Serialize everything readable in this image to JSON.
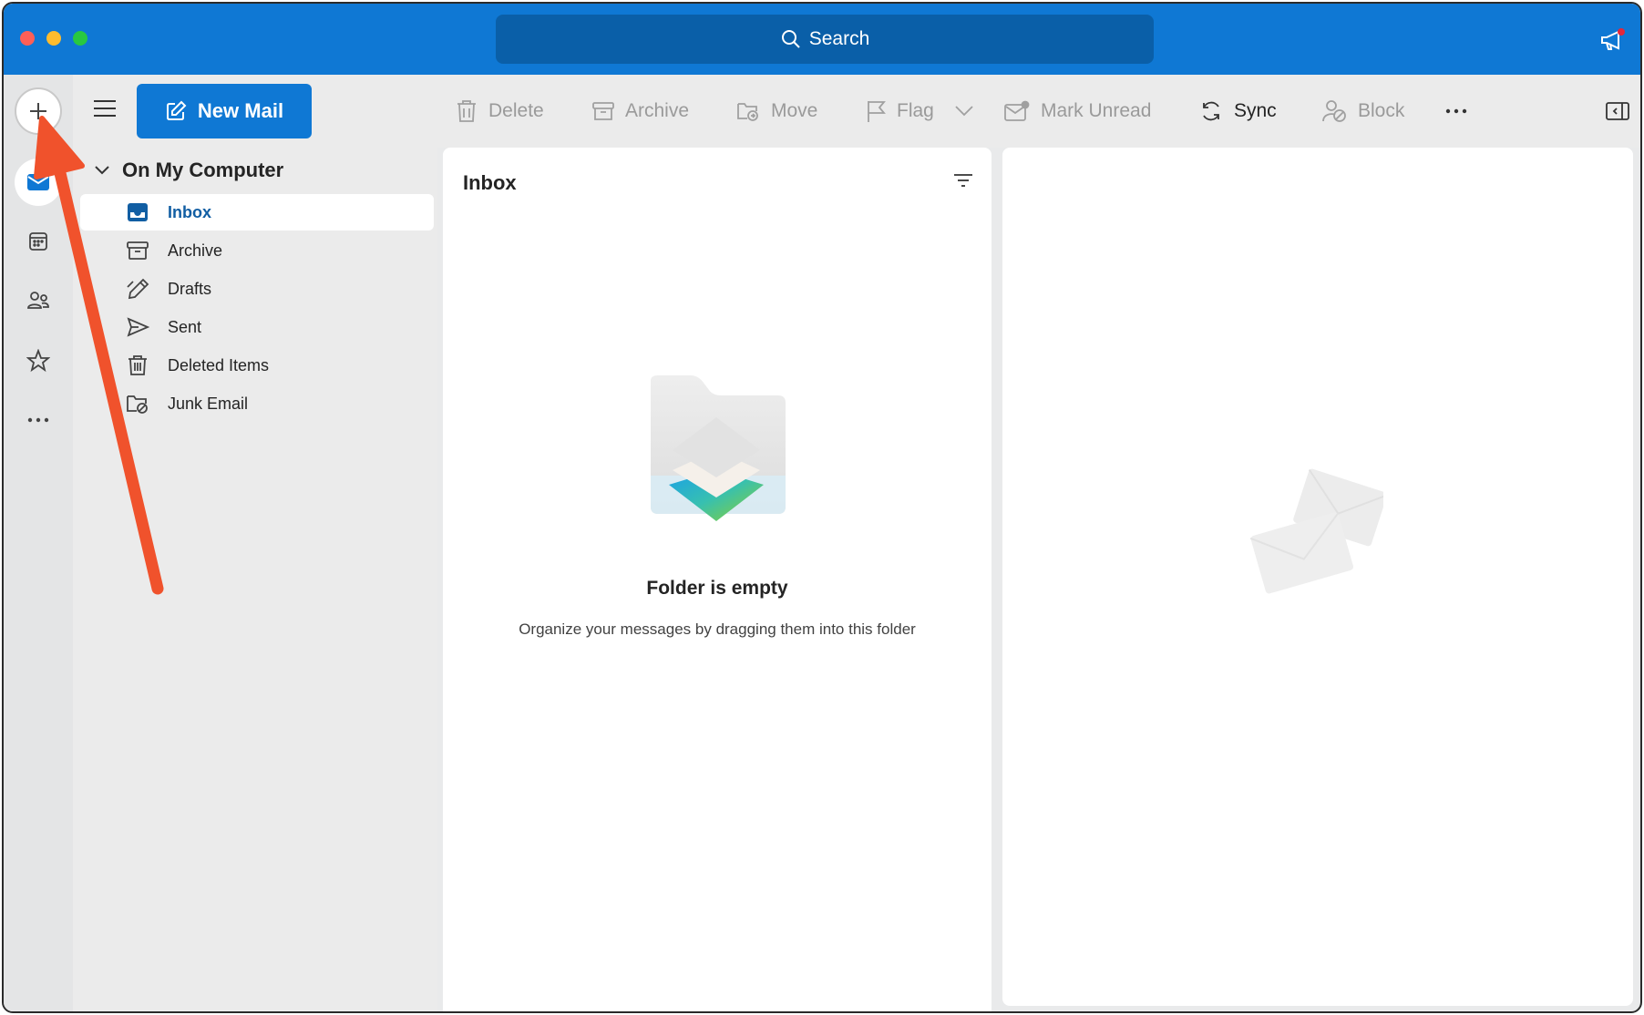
{
  "titlebar": {
    "search_label": "Search"
  },
  "rail": {
    "items": [
      "compose",
      "mail",
      "calendar",
      "people",
      "favorites",
      "more"
    ]
  },
  "folder_pane": {
    "new_mail_label": "New Mail",
    "account_label": "On My Computer",
    "folders": [
      {
        "label": "Inbox",
        "icon": "inbox-icon",
        "selected": true
      },
      {
        "label": "Archive",
        "icon": "archive-icon",
        "selected": false
      },
      {
        "label": "Drafts",
        "icon": "drafts-icon",
        "selected": false
      },
      {
        "label": "Sent",
        "icon": "sent-icon",
        "selected": false
      },
      {
        "label": "Deleted Items",
        "icon": "trash-icon",
        "selected": false
      },
      {
        "label": "Junk Email",
        "icon": "junk-icon",
        "selected": false
      }
    ]
  },
  "toolbar": {
    "delete_label": "Delete",
    "archive_label": "Archive",
    "move_label": "Move",
    "flag_label": "Flag",
    "mark_unread_label": "Mark Unread",
    "sync_label": "Sync",
    "block_label": "Block",
    "more_label": "···"
  },
  "message_list": {
    "title": "Inbox",
    "empty_title": "Folder is empty",
    "empty_subtitle": "Organize your messages by dragging them into this folder"
  },
  "colors": {
    "accent": "#0f78d4",
    "annotation_arrow": "#f0522c"
  }
}
